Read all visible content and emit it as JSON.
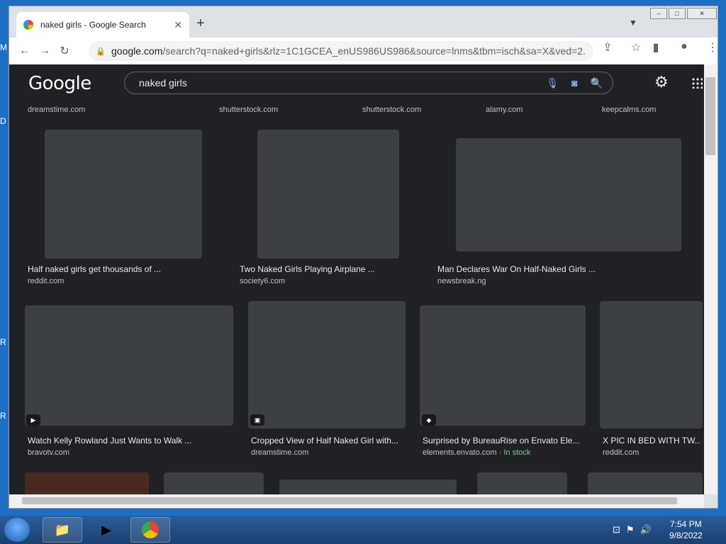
{
  "browser": {
    "tab_title": "naked girls - Google Search",
    "tab_close": "✕",
    "new_tab": "+",
    "url_host": "google.com",
    "url_path": "/search?q=naked+girls&rlz=1C1GCEA_enUS986US986&source=lnms&tbm=isch&sa=X&ved=2..."
  },
  "google": {
    "logo": "Google",
    "query": "naked girls"
  },
  "results": {
    "top_sources": [
      "dreamstime.com",
      "shutterstock.com",
      "shutterstock.com",
      "alamy.com",
      "keepcalms.com"
    ],
    "row1": [
      {
        "caption": "Half naked girls get thousands of ...",
        "source": "reddit.com"
      },
      {
        "caption": "Two Naked Girls Playing Airplane ...",
        "source": "society6.com"
      },
      {
        "caption": "Man Declares War On Half-Naked Girls ...",
        "source": "newsbreak.ng"
      }
    ],
    "row2": [
      {
        "caption": "Watch Kelly Rowland Just Wants to Walk ...",
        "source": "bravotv.com"
      },
      {
        "caption": "Cropped View of Half Naked Girl with...",
        "source": "dreamstime.com"
      },
      {
        "caption": "Surprised by BureauRise on Envato Ele...",
        "source": "elements.envato.com",
        "stock": " · In stock"
      },
      {
        "caption": "X PIC IN BED WITH TW...",
        "source": "reddit.com"
      }
    ]
  },
  "taskbar": {
    "time": "7:54 PM",
    "date": "9/8/2022"
  },
  "desktop_letters": [
    "M",
    "D",
    "R",
    "R"
  ]
}
